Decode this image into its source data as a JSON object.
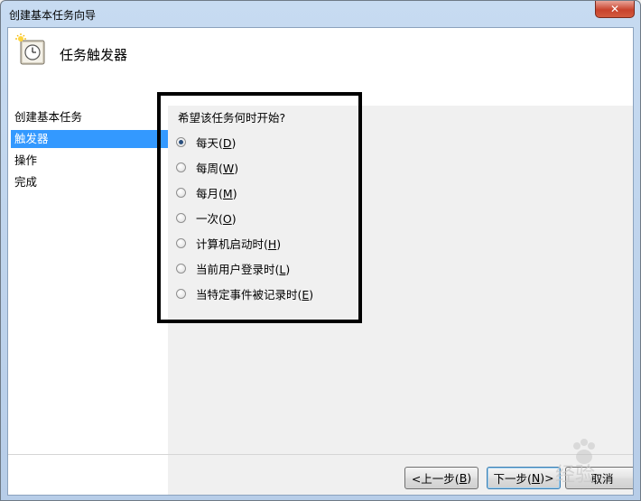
{
  "window": {
    "title": "创建基本任务向导",
    "close_icon": "close-icon"
  },
  "header": {
    "title": "任务触发器",
    "icon": "task-clock-icon"
  },
  "sidebar": {
    "items": [
      {
        "label": "创建基本任务",
        "selected": false
      },
      {
        "label": "触发器",
        "selected": true
      },
      {
        "label": "操作",
        "selected": false
      },
      {
        "label": "完成",
        "selected": false
      }
    ]
  },
  "main": {
    "question": "希望该任务何时开始?",
    "options": [
      {
        "label": "每天(D)",
        "text": "每天(",
        "key": "D",
        "checked": true
      },
      {
        "label": "每周(W)",
        "text": "每周(",
        "key": "W",
        "checked": false
      },
      {
        "label": "每月(M)",
        "text": "每月(",
        "key": "M",
        "checked": false
      },
      {
        "label": "一次(O)",
        "text": "一次(",
        "key": "O",
        "checked": false
      },
      {
        "label": "计算机启动时(H)",
        "text": "计算机启动时(",
        "key": "H",
        "checked": false
      },
      {
        "label": "当前用户登录时(L)",
        "text": "当前用户登录时(",
        "key": "L",
        "checked": false
      },
      {
        "label": "当特定事件被记录时(E)",
        "text": "当特定事件被记录时(",
        "key": "E",
        "checked": false
      }
    ]
  },
  "footer": {
    "back_prefix": "<上一步(",
    "back_key": "B",
    "next_prefix": "下一步(",
    "next_key": "N",
    "cancel_label": "取消"
  },
  "watermark": {
    "text": "经验"
  }
}
